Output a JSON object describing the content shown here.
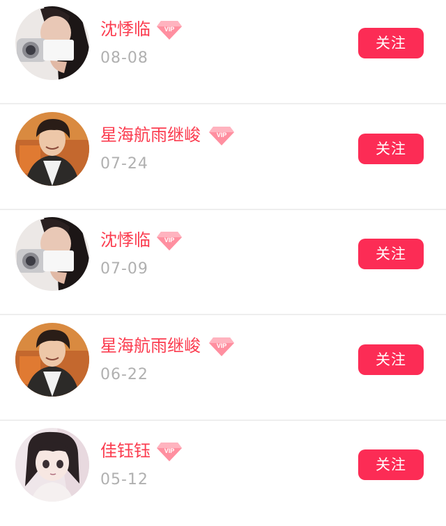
{
  "users": [
    {
      "name": "沈悸临",
      "date": "08-08",
      "vip": true,
      "avatar": "camera-girl-avatar",
      "follow_label": "关注"
    },
    {
      "name": "星海航雨继峻",
      "date": "07-24",
      "vip": true,
      "avatar": "young-man-avatar",
      "follow_label": "关注"
    },
    {
      "name": "沈悸临",
      "date": "07-09",
      "vip": true,
      "avatar": "camera-girl-avatar",
      "follow_label": "关注"
    },
    {
      "name": "星海航雨继峻",
      "date": "06-22",
      "vip": true,
      "avatar": "young-man-avatar",
      "follow_label": "关注"
    },
    {
      "name": "佳钰钰",
      "date": "05-12",
      "vip": true,
      "avatar": "anime-girl-avatar",
      "follow_label": "关注"
    }
  ],
  "badge_text": "VIP",
  "colors": {
    "name": "#fb3c4f",
    "date": "#b0b0b0",
    "follow_button": "#fc2c55",
    "divider": "#eeeeee"
  }
}
